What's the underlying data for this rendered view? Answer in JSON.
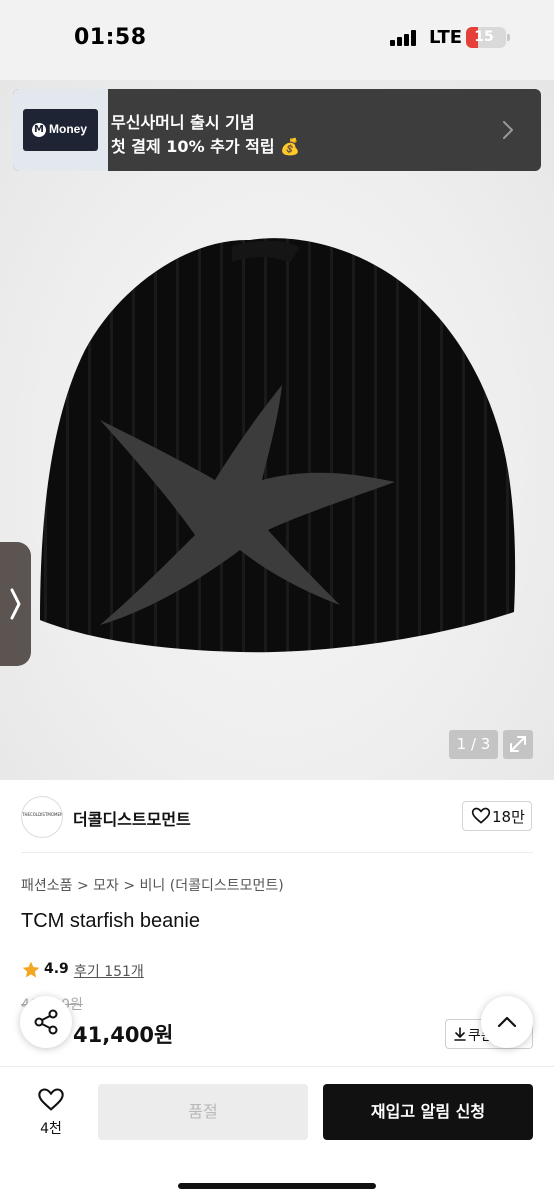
{
  "status_bar": {
    "time": "01:58",
    "network": "LTE",
    "battery_level": "15",
    "battery_color": "#e5413a"
  },
  "ad_banner": {
    "logo_text": "Money",
    "logo_mark": "M",
    "line1": "무신사머니 출시 기념",
    "line2": "첫 결제 10% 추가 적립 💰",
    "arrow_icon": "chevron-right-icon"
  },
  "gallery": {
    "counter": "1 / 3",
    "expand_icon": "expand-icon",
    "side_tab_icon": "chevron-right-icon"
  },
  "shop": {
    "logo_text": "THECOLDISTMOMENT",
    "name": "더콜디스트모먼트",
    "like_count": "18만"
  },
  "product": {
    "breadcrumb": "패션소품 > 모자 > 비니 (더콜디스트모먼트)",
    "title": "TCM starfish beanie",
    "rating": "4.9",
    "reviews": "후기 151개",
    "original_price": "46,000원",
    "sale_price": "41,400원",
    "coupon_label": "쿠폰"
  },
  "bottom_bar": {
    "wish_count": "4천",
    "soldout_label": "품절",
    "restock_label": "재입고 알림 신청"
  },
  "colors": {
    "accent": "#111111",
    "star": "#f5a623",
    "discount": "#e5413a"
  }
}
